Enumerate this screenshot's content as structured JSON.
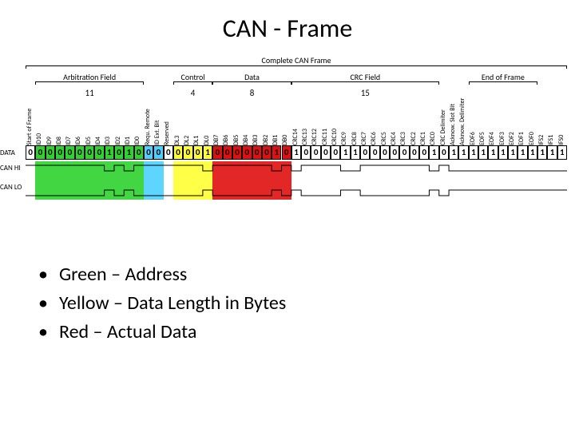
{
  "title": "CAN - Frame",
  "complete_label": "Complete CAN Frame",
  "fields": [
    {
      "name": "Arbitration Field",
      "count": "11"
    },
    {
      "name": "Control",
      "count": "4"
    },
    {
      "name": "Data",
      "count": "8"
    },
    {
      "name": "CRC Field",
      "count": "15"
    },
    {
      "name": "End of Frame",
      "count": ""
    }
  ],
  "row_labels": {
    "data": "DATA",
    "hi": "CAN HI",
    "lo": "CAN LO"
  },
  "columns": [
    {
      "lbl": "Start of Frame",
      "bit": "0",
      "bg": "#ffffff"
    },
    {
      "lbl": "ID10",
      "bit": "0",
      "bg": "#2fd22f"
    },
    {
      "lbl": "ID9",
      "bit": "0",
      "bg": "#2fd22f"
    },
    {
      "lbl": "ID8",
      "bit": "0",
      "bg": "#2fd22f"
    },
    {
      "lbl": "ID7",
      "bit": "0",
      "bg": "#2fd22f"
    },
    {
      "lbl": "ID6",
      "bit": "0",
      "bg": "#2fd22f"
    },
    {
      "lbl": "ID5",
      "bit": "0",
      "bg": "#2fd22f"
    },
    {
      "lbl": "ID4",
      "bit": "0",
      "bg": "#2fd22f"
    },
    {
      "lbl": "ID3",
      "bit": "1",
      "bg": "#2fd22f"
    },
    {
      "lbl": "ID2",
      "bit": "0",
      "bg": "#2fd22f"
    },
    {
      "lbl": "ID1",
      "bit": "1",
      "bg": "#2fd22f"
    },
    {
      "lbl": "ID0",
      "bit": "0",
      "bg": "#2fd22f"
    },
    {
      "lbl": "Requ. Remote",
      "bit": "0",
      "bg": "#4dd0ff"
    },
    {
      "lbl": "ID Ext. Bit",
      "bit": "0",
      "bg": "#4dd0ff"
    },
    {
      "lbl": "Reserved",
      "bit": "0",
      "bg": "#ffffff"
    },
    {
      "lbl": "DL3",
      "bit": "0",
      "bg": "#ffff33"
    },
    {
      "lbl": "DL2",
      "bit": "0",
      "bg": "#ffff33"
    },
    {
      "lbl": "DL1",
      "bit": "0",
      "bg": "#ffff33"
    },
    {
      "lbl": "DL0",
      "bit": "1",
      "bg": "#ffff33"
    },
    {
      "lbl": "DB7",
      "bit": "0",
      "bg": "#e01010"
    },
    {
      "lbl": "DB6",
      "bit": "0",
      "bg": "#e01010"
    },
    {
      "lbl": "DB5",
      "bit": "0",
      "bg": "#e01010"
    },
    {
      "lbl": "DB4",
      "bit": "0",
      "bg": "#e01010"
    },
    {
      "lbl": "DB3",
      "bit": "0",
      "bg": "#e01010"
    },
    {
      "lbl": "DB2",
      "bit": "0",
      "bg": "#e01010"
    },
    {
      "lbl": "DB1",
      "bit": "1",
      "bg": "#e01010"
    },
    {
      "lbl": "DB0",
      "bit": "0",
      "bg": "#e01010"
    },
    {
      "lbl": "CRC14",
      "bit": "1",
      "bg": "#ffffff"
    },
    {
      "lbl": "CRC13",
      "bit": "0",
      "bg": "#ffffff"
    },
    {
      "lbl": "CRC12",
      "bit": "0",
      "bg": "#ffffff"
    },
    {
      "lbl": "CRC11",
      "bit": "0",
      "bg": "#ffffff"
    },
    {
      "lbl": "CRC10",
      "bit": "0",
      "bg": "#ffffff"
    },
    {
      "lbl": "CRC9",
      "bit": "1",
      "bg": "#ffffff"
    },
    {
      "lbl": "CRC8",
      "bit": "1",
      "bg": "#ffffff"
    },
    {
      "lbl": "CRC7",
      "bit": "0",
      "bg": "#ffffff"
    },
    {
      "lbl": "CRC6",
      "bit": "0",
      "bg": "#ffffff"
    },
    {
      "lbl": "CRC5",
      "bit": "0",
      "bg": "#ffffff"
    },
    {
      "lbl": "CRC4",
      "bit": "0",
      "bg": "#ffffff"
    },
    {
      "lbl": "CRC3",
      "bit": "0",
      "bg": "#ffffff"
    },
    {
      "lbl": "CRC2",
      "bit": "0",
      "bg": "#ffffff"
    },
    {
      "lbl": "CRC1",
      "bit": "0",
      "bg": "#ffffff"
    },
    {
      "lbl": "CRC0",
      "bit": "1",
      "bg": "#ffffff"
    },
    {
      "lbl": "CRC Delimiter",
      "bit": "0",
      "bg": "#ffffff"
    },
    {
      "lbl": "Acknow. Slot Bit",
      "bit": "1",
      "bg": "#ffffff"
    },
    {
      "lbl": "Acknow. Delimiter",
      "bit": "1",
      "bg": "#ffffff"
    },
    {
      "lbl": "EOF6",
      "bit": "1",
      "bg": "#ffffff"
    },
    {
      "lbl": "EOF5",
      "bit": "1",
      "bg": "#ffffff"
    },
    {
      "lbl": "EOF4",
      "bit": "1",
      "bg": "#ffffff"
    },
    {
      "lbl": "EOF3",
      "bit": "1",
      "bg": "#ffffff"
    },
    {
      "lbl": "EOF2",
      "bit": "1",
      "bg": "#ffffff"
    },
    {
      "lbl": "EOF1",
      "bit": "1",
      "bg": "#ffffff"
    },
    {
      "lbl": "EOF0",
      "bit": "1",
      "bg": "#ffffff"
    },
    {
      "lbl": "IFS2",
      "bit": "1",
      "bg": "#ffffff"
    },
    {
      "lbl": "IFS1",
      "bit": "1",
      "bg": "#ffffff"
    },
    {
      "lbl": "IFS0",
      "bit": "1",
      "bg": "#ffffff"
    }
  ],
  "bullets": [
    "Green – Address",
    "Yellow – Data Length in Bytes",
    "Red – Actual Data"
  ]
}
